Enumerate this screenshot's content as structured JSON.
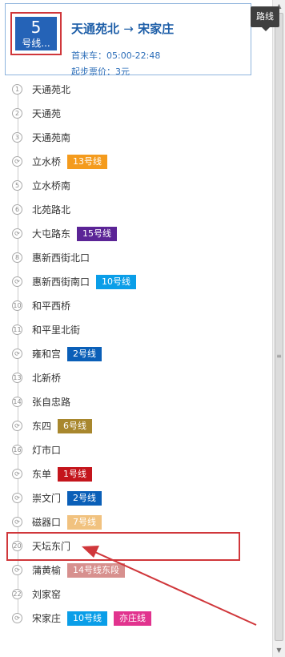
{
  "tooltip": "路线",
  "header": {
    "line_number": "5",
    "line_label": "号线...",
    "from": "天通苑北",
    "arrow": "→",
    "to": "宋家庄",
    "times": "首末车：05:00-22:48",
    "fare": "起步票价：3元"
  },
  "stations": [
    {
      "marker": "1",
      "name": "天通苑北",
      "lines": []
    },
    {
      "marker": "2",
      "name": "天通苑",
      "lines": []
    },
    {
      "marker": "3",
      "name": "天通苑南",
      "lines": []
    },
    {
      "marker": "⟳",
      "name": "立水桥",
      "lines": [
        {
          "label": "13号线",
          "color": "#f49b1d"
        }
      ]
    },
    {
      "marker": "5",
      "name": "立水桥南",
      "lines": []
    },
    {
      "marker": "6",
      "name": "北苑路北",
      "lines": []
    },
    {
      "marker": "⟳",
      "name": "大屯路东",
      "lines": [
        {
          "label": "15号线",
          "color": "#5b2496"
        }
      ]
    },
    {
      "marker": "8",
      "name": "惠新西街北口",
      "lines": []
    },
    {
      "marker": "⟳",
      "name": "惠新西街南口",
      "lines": [
        {
          "label": "10号线",
          "color": "#0a9ee8"
        }
      ]
    },
    {
      "marker": "10",
      "name": "和平西桥",
      "lines": []
    },
    {
      "marker": "11",
      "name": "和平里北街",
      "lines": []
    },
    {
      "marker": "⟳",
      "name": "雍和宫",
      "lines": [
        {
          "label": "2号线",
          "color": "#0a5fb8"
        }
      ]
    },
    {
      "marker": "13",
      "name": "北新桥",
      "lines": []
    },
    {
      "marker": "14",
      "name": "张自忠路",
      "lines": []
    },
    {
      "marker": "⟳",
      "name": "东四",
      "lines": [
        {
          "label": "6号线",
          "color": "#a8872d"
        }
      ]
    },
    {
      "marker": "16",
      "name": "灯市口",
      "lines": []
    },
    {
      "marker": "⟳",
      "name": "东单",
      "lines": [
        {
          "label": "1号线",
          "color": "#c4151c"
        }
      ]
    },
    {
      "marker": "⟳",
      "name": "崇文门",
      "lines": [
        {
          "label": "2号线",
          "color": "#0a5fb8"
        }
      ]
    },
    {
      "marker": "⟳",
      "name": "磁器口",
      "lines": [
        {
          "label": "7号线",
          "color": "#f1c27f"
        }
      ]
    },
    {
      "marker": "20",
      "name": "天坛东门",
      "lines": []
    },
    {
      "marker": "⟳",
      "name": "蒲黄榆",
      "lines": [
        {
          "label": "14号线东段",
          "color": "#d7908e"
        }
      ]
    },
    {
      "marker": "22",
      "name": "刘家窑",
      "lines": []
    },
    {
      "marker": "⟳",
      "name": "宋家庄",
      "lines": [
        {
          "label": "10号线",
          "color": "#0a9ee8"
        },
        {
          "label": "亦庄线",
          "color": "#e1338e"
        }
      ]
    }
  ],
  "colors": {
    "accent": "#2563b7",
    "annotation": "#d0373b"
  }
}
